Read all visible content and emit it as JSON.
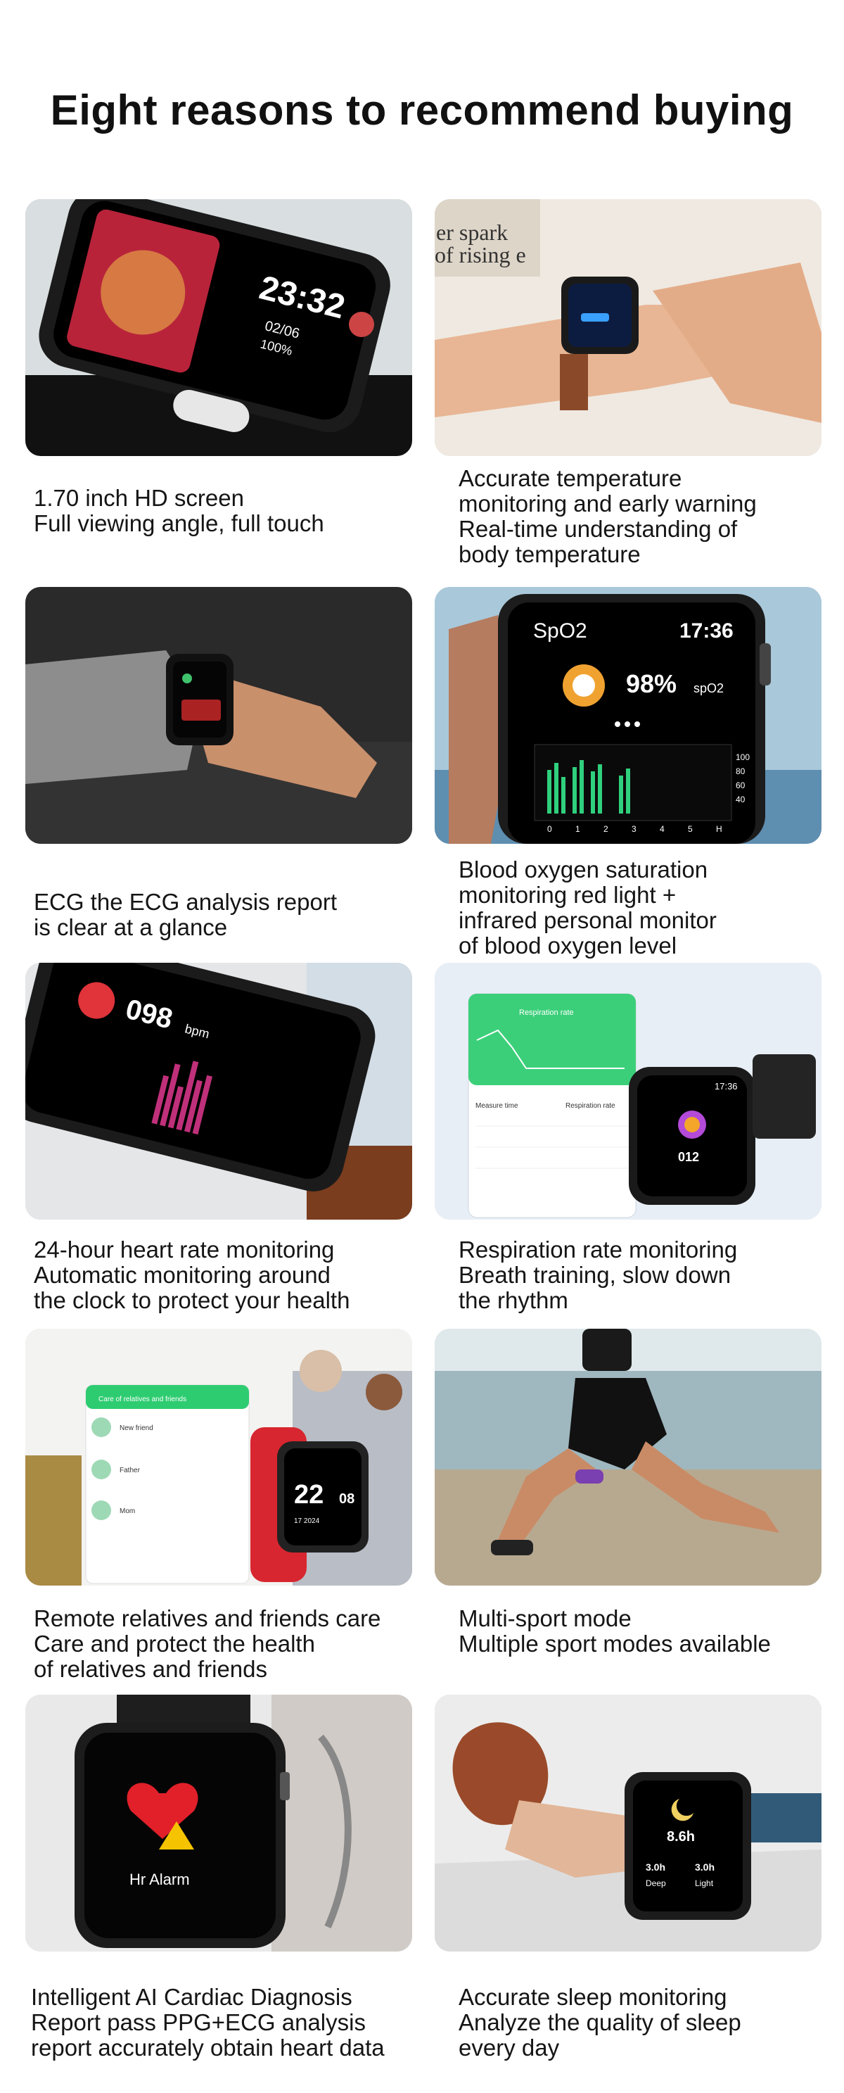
{
  "title": "Eight reasons to recommend buying",
  "features": [
    {
      "lines": [
        "1.70 inch HD screen",
        "Full viewing angle, full touch"
      ],
      "image_text": [
        "23:32",
        "02/06",
        "100%"
      ]
    },
    {
      "lines": [
        "Accurate temperature",
        "monitoring and early warning",
        "Real-time understanding of",
        "body temperature"
      ],
      "image_text": [
        "er spark",
        "of rising e"
      ]
    },
    {
      "lines": [
        "ECG the ECG analysis report",
        "is clear at a glance"
      ],
      "image_text": []
    },
    {
      "lines": [
        "Blood oxygen saturation",
        "monitoring red light +",
        "infrared personal monitor",
        "of blood oxygen level"
      ],
      "image_text": [
        "SpO2",
        "17:36",
        "98%",
        "spO2",
        "100",
        "80",
        "60",
        "40",
        "0",
        "1",
        "2",
        "3",
        "4",
        "5",
        "H"
      ]
    },
    {
      "lines": [
        "24-hour heart rate monitoring",
        "Automatic monitoring around",
        "the clock to protect your health"
      ],
      "image_text": [
        "098",
        "bpm"
      ]
    },
    {
      "lines": [
        "Respiration rate monitoring",
        "Breath training, slow down",
        "the rhythm"
      ],
      "image_text": [
        "Respiration rate",
        "Measure time",
        "Respiration rate",
        "17:36",
        "012"
      ]
    },
    {
      "lines": [
        "Remote relatives and friends care",
        "Care and protect the health",
        "of relatives and friends"
      ],
      "image_text": [
        "Care of relatives and friends",
        "New friend",
        "Father",
        "Mom",
        "22",
        "08",
        "17 2024"
      ]
    },
    {
      "lines": [
        "Multi-sport mode",
        "Multiple sport modes available"
      ],
      "image_text": []
    },
    {
      "lines": [
        "Intelligent AI Cardiac Diagnosis",
        "Report pass PPG+ECG analysis",
        "report accurately obtain heart data"
      ],
      "image_text": [
        "Hr Alarm"
      ]
    },
    {
      "lines": [
        "Accurate sleep monitoring",
        "Analyze the quality of sleep",
        "every day"
      ],
      "image_text": [
        "8.6h",
        "3.0h",
        "3.0h",
        "Deep",
        "Light"
      ]
    }
  ]
}
